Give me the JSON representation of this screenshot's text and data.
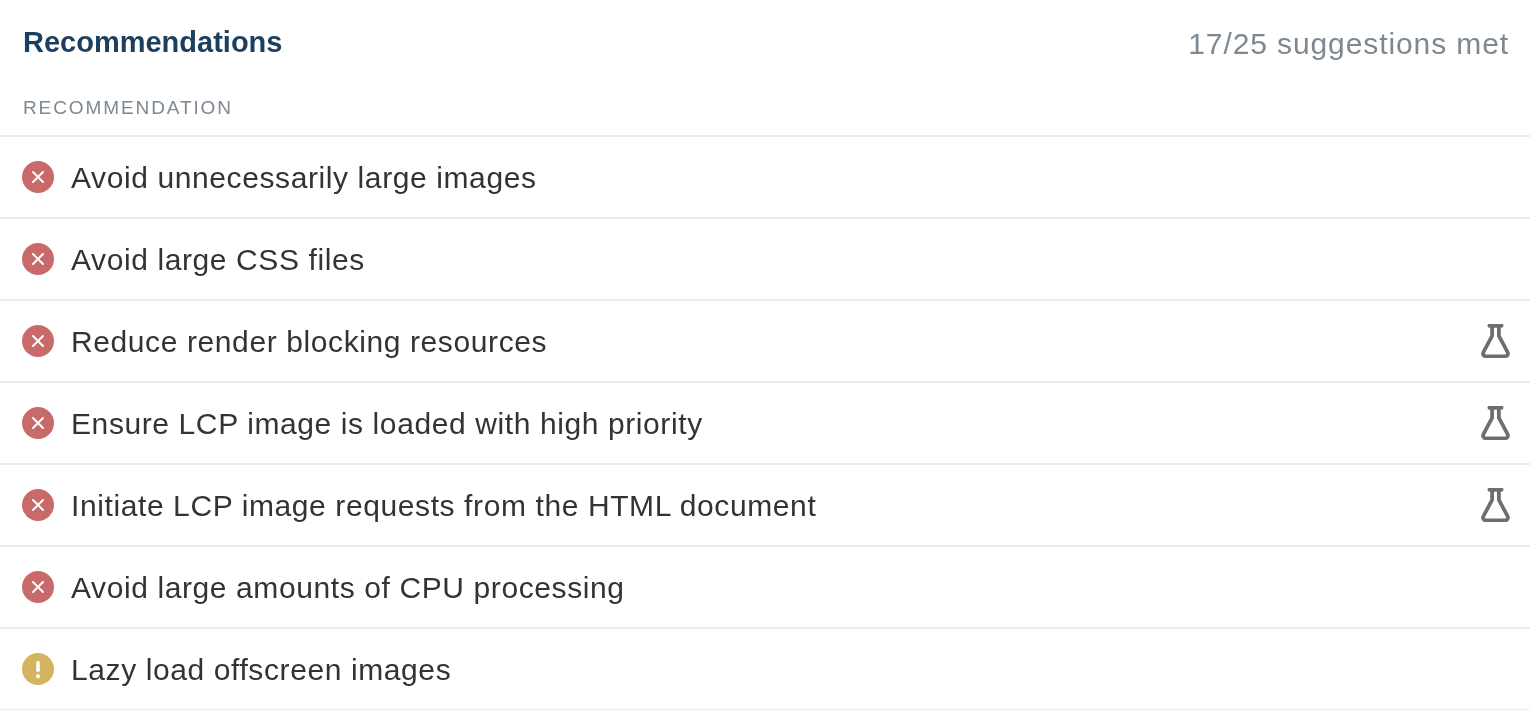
{
  "header": {
    "title": "Recommendations",
    "summary": "17/25 suggestions met"
  },
  "table": {
    "columns": [
      "RECOMMENDATION"
    ],
    "rows": [
      {
        "label": "Avoid unnecessarily large images",
        "kind": "error",
        "experimental": false
      },
      {
        "label": "Avoid large CSS files",
        "kind": "error",
        "experimental": false
      },
      {
        "label": "Reduce render blocking resources",
        "kind": "error",
        "experimental": true
      },
      {
        "label": "Ensure LCP image is loaded with high priority",
        "kind": "error",
        "experimental": true
      },
      {
        "label": "Initiate LCP image requests from the HTML document",
        "kind": "error",
        "experimental": true
      },
      {
        "label": "Avoid large amounts of CPU processing",
        "kind": "error",
        "experimental": false
      },
      {
        "label": "Lazy load offscreen images",
        "kind": "warning",
        "experimental": false
      }
    ]
  }
}
